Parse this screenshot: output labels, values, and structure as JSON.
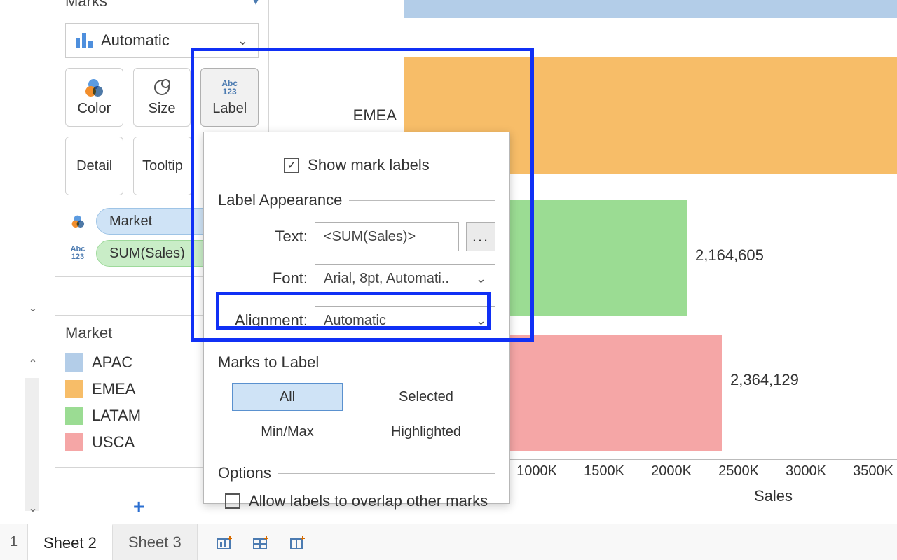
{
  "marks": {
    "title": "Marks",
    "type_label": "Automatic",
    "buttons": {
      "color": "Color",
      "size": "Size",
      "label": "Label",
      "detail": "Detail",
      "tooltip": "Tooltip"
    },
    "label_icon": "Abc\n123",
    "pills": {
      "color": "Market",
      "label": "SUM(Sales)"
    }
  },
  "legend": {
    "title": "Market",
    "items": [
      "APAC",
      "EMEA",
      "LATAM",
      "USCA"
    ]
  },
  "chart_data": {
    "type": "bar",
    "orientation": "horizontal",
    "categories": [
      "APAC",
      "EMEA",
      "LATAM",
      "USCA"
    ],
    "values": [
      3500000,
      3550000,
      2164605,
      2364129
    ],
    "data_labels_visible": [
      null,
      null,
      "2,164,605",
      "2,364,129"
    ],
    "row_label_visible": "EMEA",
    "xlabel": "Sales",
    "xticks": [
      "1000K",
      "1500K",
      "2000K",
      "2500K",
      "3000K",
      "3500K"
    ],
    "xlim": [
      0,
      3600000
    ],
    "colors": {
      "APAC": "#b3cde8",
      "EMEA": "#f7bd68",
      "LATAM": "#9bdc93",
      "USCA": "#f5a6a6"
    }
  },
  "popover": {
    "show_labels": "Show mark labels",
    "show_labels_checked": true,
    "appearance": "Label Appearance",
    "text_label": "Text:",
    "text_value": "<SUM(Sales)>",
    "dots": "...",
    "font_label": "Font:",
    "font_value": "Arial, 8pt, Automati..",
    "align_label": "Alignment:",
    "align_value": "Automatic",
    "marks_to_label": "Marks to Label",
    "seg": {
      "all": "All",
      "selected": "Selected",
      "minmax": "Min/Max",
      "highlighted": "Highlighted"
    },
    "options": "Options",
    "overlap": "Allow labels to overlap other marks",
    "overlap_checked": false
  },
  "tabs": {
    "num": "1",
    "sheet2": "Sheet 2",
    "sheet3": "Sheet 3"
  }
}
